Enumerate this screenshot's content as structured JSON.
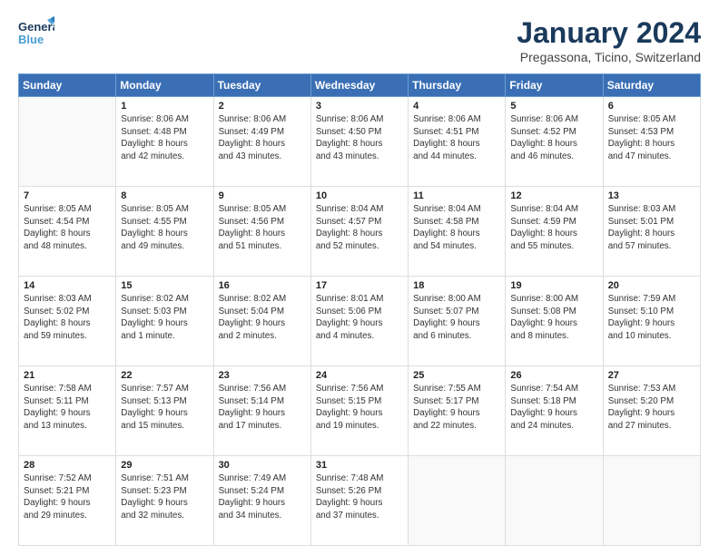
{
  "logo": {
    "line1": "General",
    "line2": "Blue"
  },
  "title": "January 2024",
  "subtitle": "Pregassona, Ticino, Switzerland",
  "days_of_week": [
    "Sunday",
    "Monday",
    "Tuesday",
    "Wednesday",
    "Thursday",
    "Friday",
    "Saturday"
  ],
  "weeks": [
    [
      {
        "day": "",
        "info": ""
      },
      {
        "day": "1",
        "info": "Sunrise: 8:06 AM\nSunset: 4:48 PM\nDaylight: 8 hours\nand 42 minutes."
      },
      {
        "day": "2",
        "info": "Sunrise: 8:06 AM\nSunset: 4:49 PM\nDaylight: 8 hours\nand 43 minutes."
      },
      {
        "day": "3",
        "info": "Sunrise: 8:06 AM\nSunset: 4:50 PM\nDaylight: 8 hours\nand 43 minutes."
      },
      {
        "day": "4",
        "info": "Sunrise: 8:06 AM\nSunset: 4:51 PM\nDaylight: 8 hours\nand 44 minutes."
      },
      {
        "day": "5",
        "info": "Sunrise: 8:06 AM\nSunset: 4:52 PM\nDaylight: 8 hours\nand 46 minutes."
      },
      {
        "day": "6",
        "info": "Sunrise: 8:05 AM\nSunset: 4:53 PM\nDaylight: 8 hours\nand 47 minutes."
      }
    ],
    [
      {
        "day": "7",
        "info": "Sunrise: 8:05 AM\nSunset: 4:54 PM\nDaylight: 8 hours\nand 48 minutes."
      },
      {
        "day": "8",
        "info": "Sunrise: 8:05 AM\nSunset: 4:55 PM\nDaylight: 8 hours\nand 49 minutes."
      },
      {
        "day": "9",
        "info": "Sunrise: 8:05 AM\nSunset: 4:56 PM\nDaylight: 8 hours\nand 51 minutes."
      },
      {
        "day": "10",
        "info": "Sunrise: 8:04 AM\nSunset: 4:57 PM\nDaylight: 8 hours\nand 52 minutes."
      },
      {
        "day": "11",
        "info": "Sunrise: 8:04 AM\nSunset: 4:58 PM\nDaylight: 8 hours\nand 54 minutes."
      },
      {
        "day": "12",
        "info": "Sunrise: 8:04 AM\nSunset: 4:59 PM\nDaylight: 8 hours\nand 55 minutes."
      },
      {
        "day": "13",
        "info": "Sunrise: 8:03 AM\nSunset: 5:01 PM\nDaylight: 8 hours\nand 57 minutes."
      }
    ],
    [
      {
        "day": "14",
        "info": "Sunrise: 8:03 AM\nSunset: 5:02 PM\nDaylight: 8 hours\nand 59 minutes."
      },
      {
        "day": "15",
        "info": "Sunrise: 8:02 AM\nSunset: 5:03 PM\nDaylight: 9 hours\nand 1 minute."
      },
      {
        "day": "16",
        "info": "Sunrise: 8:02 AM\nSunset: 5:04 PM\nDaylight: 9 hours\nand 2 minutes."
      },
      {
        "day": "17",
        "info": "Sunrise: 8:01 AM\nSunset: 5:06 PM\nDaylight: 9 hours\nand 4 minutes."
      },
      {
        "day": "18",
        "info": "Sunrise: 8:00 AM\nSunset: 5:07 PM\nDaylight: 9 hours\nand 6 minutes."
      },
      {
        "day": "19",
        "info": "Sunrise: 8:00 AM\nSunset: 5:08 PM\nDaylight: 9 hours\nand 8 minutes."
      },
      {
        "day": "20",
        "info": "Sunrise: 7:59 AM\nSunset: 5:10 PM\nDaylight: 9 hours\nand 10 minutes."
      }
    ],
    [
      {
        "day": "21",
        "info": "Sunrise: 7:58 AM\nSunset: 5:11 PM\nDaylight: 9 hours\nand 13 minutes."
      },
      {
        "day": "22",
        "info": "Sunrise: 7:57 AM\nSunset: 5:13 PM\nDaylight: 9 hours\nand 15 minutes."
      },
      {
        "day": "23",
        "info": "Sunrise: 7:56 AM\nSunset: 5:14 PM\nDaylight: 9 hours\nand 17 minutes."
      },
      {
        "day": "24",
        "info": "Sunrise: 7:56 AM\nSunset: 5:15 PM\nDaylight: 9 hours\nand 19 minutes."
      },
      {
        "day": "25",
        "info": "Sunrise: 7:55 AM\nSunset: 5:17 PM\nDaylight: 9 hours\nand 22 minutes."
      },
      {
        "day": "26",
        "info": "Sunrise: 7:54 AM\nSunset: 5:18 PM\nDaylight: 9 hours\nand 24 minutes."
      },
      {
        "day": "27",
        "info": "Sunrise: 7:53 AM\nSunset: 5:20 PM\nDaylight: 9 hours\nand 27 minutes."
      }
    ],
    [
      {
        "day": "28",
        "info": "Sunrise: 7:52 AM\nSunset: 5:21 PM\nDaylight: 9 hours\nand 29 minutes."
      },
      {
        "day": "29",
        "info": "Sunrise: 7:51 AM\nSunset: 5:23 PM\nDaylight: 9 hours\nand 32 minutes."
      },
      {
        "day": "30",
        "info": "Sunrise: 7:49 AM\nSunset: 5:24 PM\nDaylight: 9 hours\nand 34 minutes."
      },
      {
        "day": "31",
        "info": "Sunrise: 7:48 AM\nSunset: 5:26 PM\nDaylight: 9 hours\nand 37 minutes."
      },
      {
        "day": "",
        "info": ""
      },
      {
        "day": "",
        "info": ""
      },
      {
        "day": "",
        "info": ""
      }
    ]
  ]
}
